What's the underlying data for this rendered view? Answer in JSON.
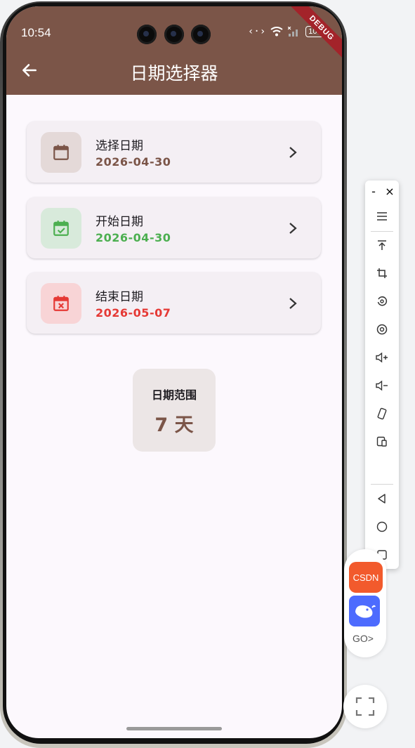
{
  "status_bar": {
    "time": "10:54",
    "battery": "100",
    "debug": "DEBUG"
  },
  "app_bar": {
    "title": "日期选择器",
    "back_icon": "arrow-back-icon",
    "color": "#7b5548"
  },
  "cards": [
    {
      "label": "选择日期",
      "value": "2026-04-30",
      "icon": "calendar-icon",
      "accent": "#7b5548",
      "bg": "#e4d9d8"
    },
    {
      "label": "开始日期",
      "value": "2026-04-30",
      "icon": "calendar-check-icon",
      "accent": "#4caf50",
      "bg": "#d8eadb"
    },
    {
      "label": "结束日期",
      "value": "2026-05-07",
      "icon": "calendar-x-icon",
      "accent": "#e53935",
      "bg": "#f8d4d6"
    }
  ],
  "range": {
    "title": "日期范围",
    "value": "7 天"
  },
  "toolbar": {
    "minimize": "-",
    "close": "×",
    "items": [
      "menu-icon",
      "scroll-top-icon",
      "crop-icon",
      "rotate-icon",
      "screenshot-icon",
      "volume-up-icon",
      "volume-down-icon",
      "rotate-device-icon",
      "multi-screen-icon",
      "back-nav-icon",
      "home-nav-icon",
      "recents-nav-icon"
    ]
  },
  "floating": {
    "csdn": "CSDN",
    "go": "GO>"
  }
}
